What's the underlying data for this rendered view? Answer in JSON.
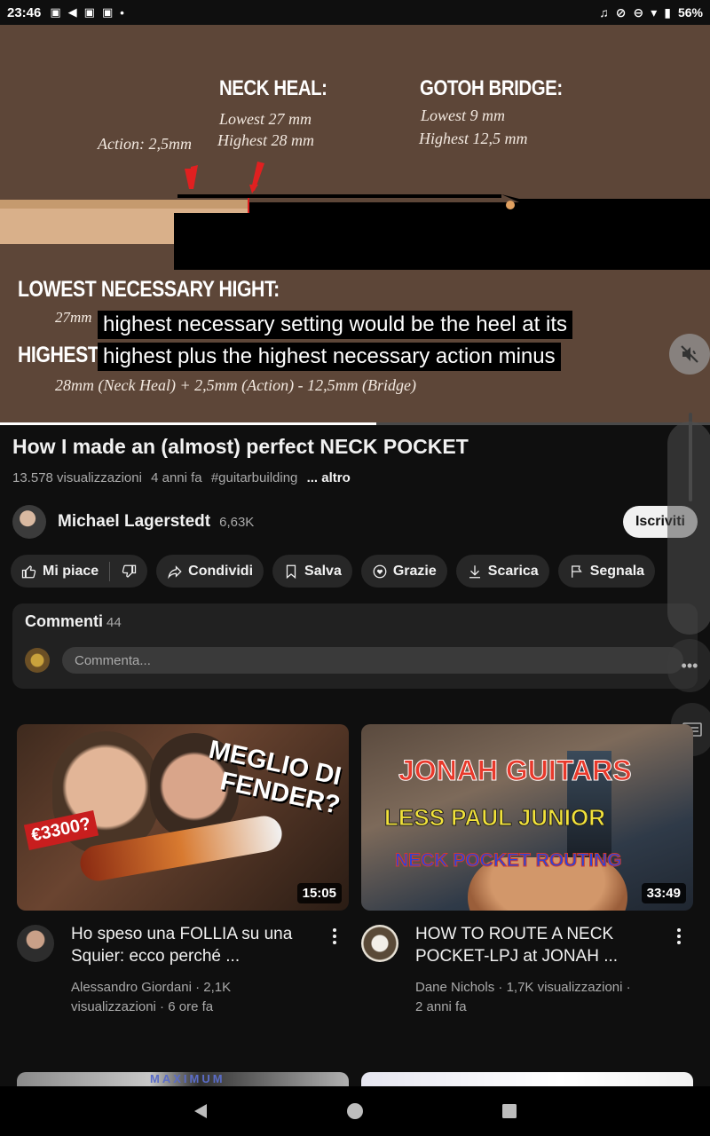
{
  "status_bar": {
    "time": "23:46",
    "battery": "56%"
  },
  "video": {
    "overlay": {
      "neck_heal_title": "NECK HEAL:",
      "neck_heal_lowest": "Lowest 27 mm",
      "neck_heal_highest": "Highest 28 mm",
      "gotoh_title": "GOTOH BRIDGE:",
      "gotoh_lowest": "Lowest 9 mm",
      "gotoh_highest": "Highest 12,5 mm",
      "action_note": "Action: 2,5mm",
      "lowest_header": "LOWEST NECESSARY HIGHT:",
      "lowest_value_partial": "27mm",
      "highest_header_partial": "HIGHEST N",
      "formula": "28mm (Neck Heal) + 2,5mm (Action) - 12,5mm (Bridge)"
    },
    "captions": [
      "highest necessary setting would be the heel at its",
      "highest plus the highest necessary action minus"
    ],
    "progress": 0.53
  },
  "info": {
    "title": "How I made an (almost) perfect NECK POCKET",
    "views": "13.578 visualizzazioni",
    "age": "4 anni fa",
    "hashtag": "#guitarbuilding",
    "more": "... altro"
  },
  "channel": {
    "name": "Michael Lagerstedt",
    "subscribers": "6,63K",
    "subscribe_label": "Iscriviti"
  },
  "actions": {
    "like": "Mi piace",
    "share": "Condividi",
    "save": "Salva",
    "thanks": "Grazie",
    "download": "Scarica",
    "report": "Segnala"
  },
  "comments": {
    "label": "Commenti",
    "count": "44",
    "placeholder": "Commenta..."
  },
  "recommendations": [
    {
      "title": "Ho speso una FOLLIA su una Squier: ecco perché ...",
      "channel": "Alessandro Giordani",
      "views": "2,1K",
      "views_label": "visualizzazioni",
      "age": "6 ore fa",
      "duration": "15:05",
      "thumb_text_1": "MEGLIO DI",
      "thumb_text_2": "FENDER?",
      "thumb_price": "€3300?"
    },
    {
      "title": "HOW TO ROUTE A NECK POCKET-LPJ at JONAH ...",
      "channel": "Dane Nichols",
      "views": "1,7K",
      "views_label": "visualizzazioni",
      "age": "2 anni fa",
      "duration": "33:49",
      "thumb_text_1": "JONAH GUITARS",
      "thumb_text_2": "LESS PAUL JUNIOR",
      "thumb_text_3": "NECK POCKET ROUTING"
    }
  ],
  "peek_text": "MAXIMUM"
}
